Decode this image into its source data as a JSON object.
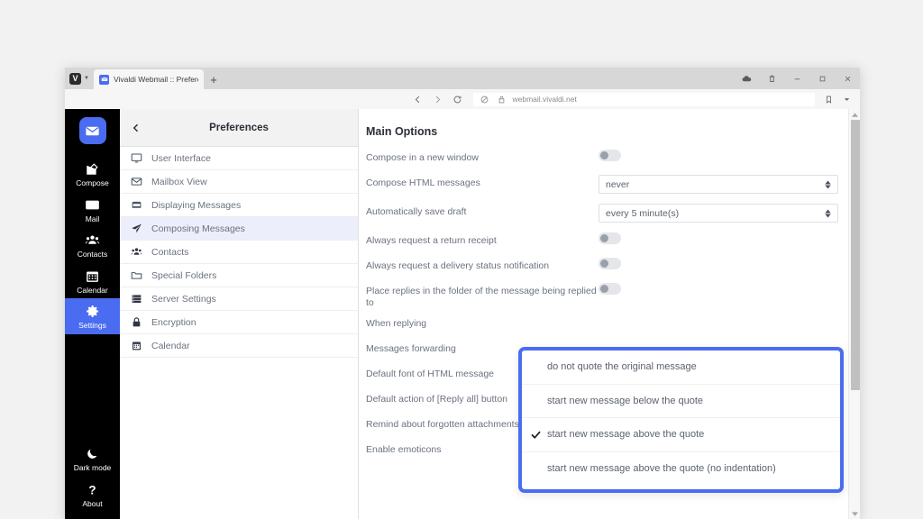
{
  "browser": {
    "vivaldi_menu_label": "V",
    "tab": {
      "title": "Vivaldi Webmail :: Preferen",
      "favicon": "mail-favicon"
    },
    "newtab_label": "+",
    "window_controls": [
      "cloud-icon",
      "trash-icon",
      "minimize-icon",
      "maximize-icon",
      "close-icon"
    ],
    "address": {
      "back": "back-icon",
      "forward": "forward-icon",
      "reload": "reload-icon",
      "shield": "shield-icon",
      "lock": "lock-icon",
      "url": "webmail.vivaldi.net",
      "bookmark": "bookmark-icon",
      "profile_caret": "chevron-down-icon"
    }
  },
  "rail": {
    "logo": "vivaldi-mail-logo",
    "items": [
      {
        "label": "Compose",
        "icon": "compose-icon",
        "active": false
      },
      {
        "label": "Mail",
        "icon": "mail-icon",
        "active": false
      },
      {
        "label": "Contacts",
        "icon": "contacts-icon",
        "active": false
      },
      {
        "label": "Calendar",
        "icon": "calendar-icon",
        "active": false
      },
      {
        "label": "Settings",
        "icon": "gear-icon",
        "active": true
      }
    ],
    "bottom": [
      {
        "label": "Dark mode",
        "icon": "moon-icon"
      },
      {
        "label": "About",
        "icon": "question-icon"
      }
    ]
  },
  "preferences": {
    "header_title": "Preferences",
    "back_icon": "chevron-left-icon",
    "items": [
      {
        "label": "User Interface",
        "icon": "monitor-icon",
        "selected": false
      },
      {
        "label": "Mailbox View",
        "icon": "envelope-icon",
        "selected": false
      },
      {
        "label": "Displaying Messages",
        "icon": "inbox-icon",
        "selected": false
      },
      {
        "label": "Composing Messages",
        "icon": "paper-plane-icon",
        "selected": true
      },
      {
        "label": "Contacts",
        "icon": "people-icon",
        "selected": false
      },
      {
        "label": "Special Folders",
        "icon": "folder-icon",
        "selected": false
      },
      {
        "label": "Server Settings",
        "icon": "server-icon",
        "selected": false
      },
      {
        "label": "Encryption",
        "icon": "lock-icon",
        "selected": false
      },
      {
        "label": "Calendar",
        "icon": "calendar-icon",
        "selected": false
      }
    ]
  },
  "main": {
    "title": "Main Options",
    "rows": [
      {
        "label": "Compose in a new window",
        "control": "toggle",
        "value": "off"
      },
      {
        "label": "Compose HTML messages",
        "control": "select",
        "value": "never"
      },
      {
        "label": "Automatically save draft",
        "control": "select",
        "value": "every 5 minute(s)"
      },
      {
        "label": "Always request a return receipt",
        "control": "toggle",
        "value": "off"
      },
      {
        "label": "Always request a delivery status notification",
        "control": "toggle",
        "value": "off"
      },
      {
        "label": "Place replies in the folder of the message being replied to",
        "control": "toggle",
        "value": "off"
      },
      {
        "label": "When replying",
        "control": "hidden",
        "value": ""
      },
      {
        "label": "Messages forwarding",
        "control": "hidden",
        "value": ""
      },
      {
        "label": "Default font of HTML message",
        "control": "hidden",
        "value": ""
      },
      {
        "label": "Default action of [Reply all] button",
        "control": "hidden",
        "value": ""
      },
      {
        "label": "Remind about forgotten attachments",
        "control": "hidden",
        "value": ""
      },
      {
        "label": "Enable emoticons",
        "control": "toggle",
        "value": "on"
      }
    ]
  },
  "dropdown": {
    "accent_color": "#4a6cf0",
    "options": [
      {
        "label": "do not quote the original message",
        "checked": false
      },
      {
        "label": "start new message below the quote",
        "checked": false
      },
      {
        "label": "start new message above the quote",
        "checked": true
      },
      {
        "label": "start new message above the quote (no indentation)",
        "checked": false
      }
    ]
  },
  "colors": {
    "accent": "#4a6cf0",
    "rail_background": "#000000",
    "page_background": "#f2f2f2",
    "selected_row": "#eceefb"
  }
}
